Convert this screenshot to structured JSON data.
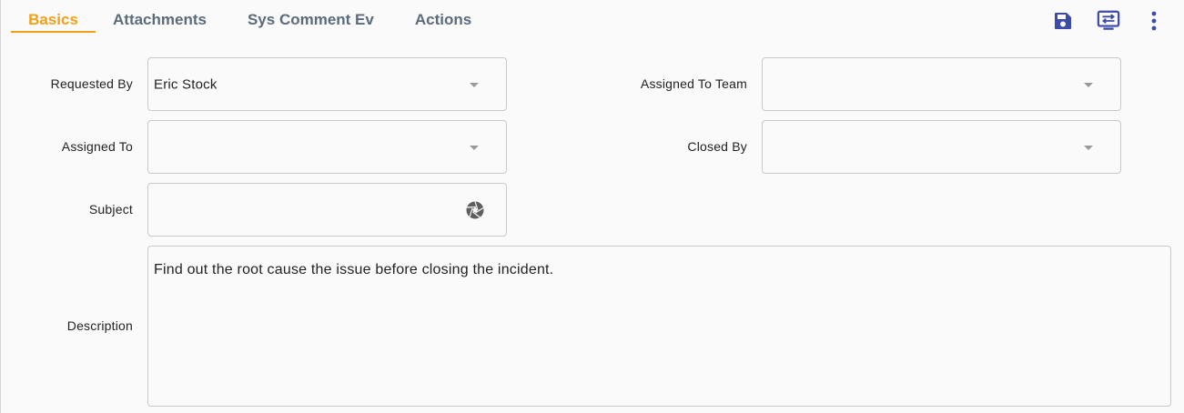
{
  "tabs": {
    "basics": "Basics",
    "attachments": "Attachments",
    "sys_comment": "Sys Comment Ev",
    "actions": "Actions"
  },
  "toolbar": {
    "save_icon": "save-icon",
    "transfer_icon": "transfer-icon",
    "more_icon": "more-vertical-icon",
    "icon_color": "#3c4ba8"
  },
  "form": {
    "requested_by": {
      "label": "Requested By",
      "value": "Eric Stock"
    },
    "assigned_to_team": {
      "label": "Assigned To Team",
      "value": ""
    },
    "assigned_to": {
      "label": "Assigned To",
      "value": ""
    },
    "closed_by": {
      "label": "Closed By",
      "value": ""
    },
    "subject": {
      "label": "Subject",
      "value": ""
    },
    "description": {
      "label": "Description",
      "value": "Find out the root cause the issue before closing the incident."
    }
  },
  "colors": {
    "accent": "#f0a019",
    "tab_text": "#5a6b7b",
    "border": "#c9c9c9",
    "background": "#fafafa"
  }
}
